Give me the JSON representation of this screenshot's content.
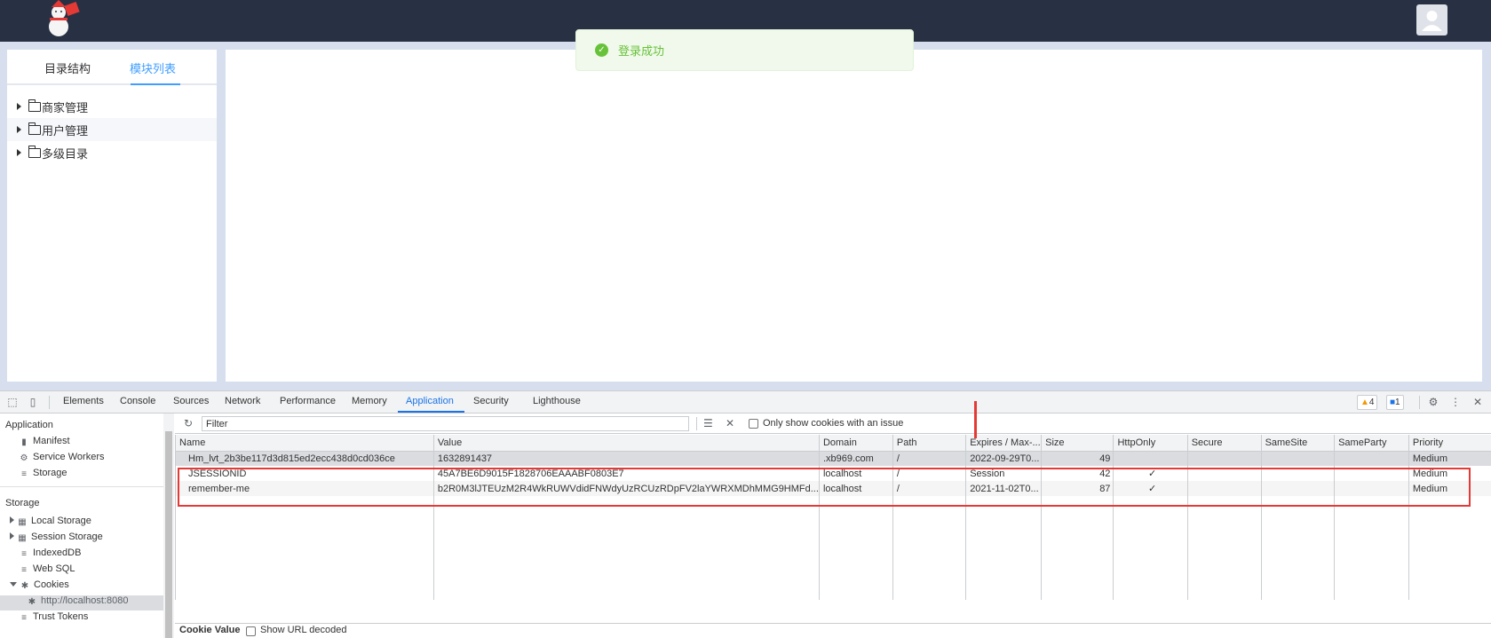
{
  "toast": {
    "text": "登录成功",
    "type": "success",
    "color": "#67c23a"
  },
  "left_panel": {
    "tabs": [
      {
        "label": "目录结构",
        "active": false
      },
      {
        "label": "模块列表",
        "active": true
      }
    ],
    "tree": [
      {
        "label": "商家管理"
      },
      {
        "label": "用户管理"
      },
      {
        "label": "多级目录"
      }
    ]
  },
  "devtools": {
    "tabs": [
      "Elements",
      "Console",
      "Sources",
      "Network",
      "Performance",
      "Memory",
      "Application",
      "Security",
      "Lighthouse"
    ],
    "active_tab": "Application",
    "warnings_count": "4",
    "messages_count": "1",
    "sidebar": {
      "application_heading": "Application",
      "application_items": [
        "Manifest",
        "Service Workers",
        "Storage"
      ],
      "storage_heading": "Storage",
      "storage_items": [
        "Local Storage",
        "Session Storage",
        "IndexedDB",
        "Web SQL",
        "Cookies"
      ],
      "cookies_child": "http://localhost:8080",
      "trust_tokens": "Trust Tokens"
    },
    "filter": {
      "placeholder": "Filter",
      "only_issues_label": "Only show cookies with an issue"
    },
    "cookie_table": {
      "columns": [
        "Name",
        "Value",
        "Domain",
        "Path",
        "Expires / Max-...",
        "Size",
        "HttpOnly",
        "Secure",
        "SameSite",
        "SameParty",
        "Priority"
      ],
      "rows": [
        {
          "name": "Hm_lvt_2b3be117d3d815ed2ecc438d0cd036ce",
          "value": "1632891437",
          "domain": ".xb969.com",
          "path": "/",
          "expires": "2022-09-29T0...",
          "size": "49",
          "httponly": "",
          "secure": "",
          "samesite": "",
          "sameparty": "",
          "priority": "Medium"
        },
        {
          "name": "JSESSIONID",
          "value": "45A7BE6D9015F1828706EAAABF0803E7",
          "domain": "localhost",
          "path": "/",
          "expires": "Session",
          "size": "42",
          "httponly": "✓",
          "secure": "",
          "samesite": "",
          "sameparty": "",
          "priority": "Medium"
        },
        {
          "name": "remember-me",
          "value": "b2R0M3lJTEUzM2R4WkRUWVdidFNWdyUzRCUzRDpFV2laYWRXMDhMMG9HMFd...",
          "domain": "localhost",
          "path": "/",
          "expires": "2021-11-02T0...",
          "size": "87",
          "httponly": "✓",
          "secure": "",
          "samesite": "",
          "sameparty": "",
          "priority": "Medium"
        }
      ]
    },
    "bottom_bar": {
      "cookie_value_label": "Cookie Value",
      "show_url_decoded": "Show URL decoded"
    }
  },
  "colors": {
    "header_bg": "#283044",
    "accent": "#409eff",
    "devtools_accent": "#1a73e8",
    "annotation": "#e53935"
  }
}
